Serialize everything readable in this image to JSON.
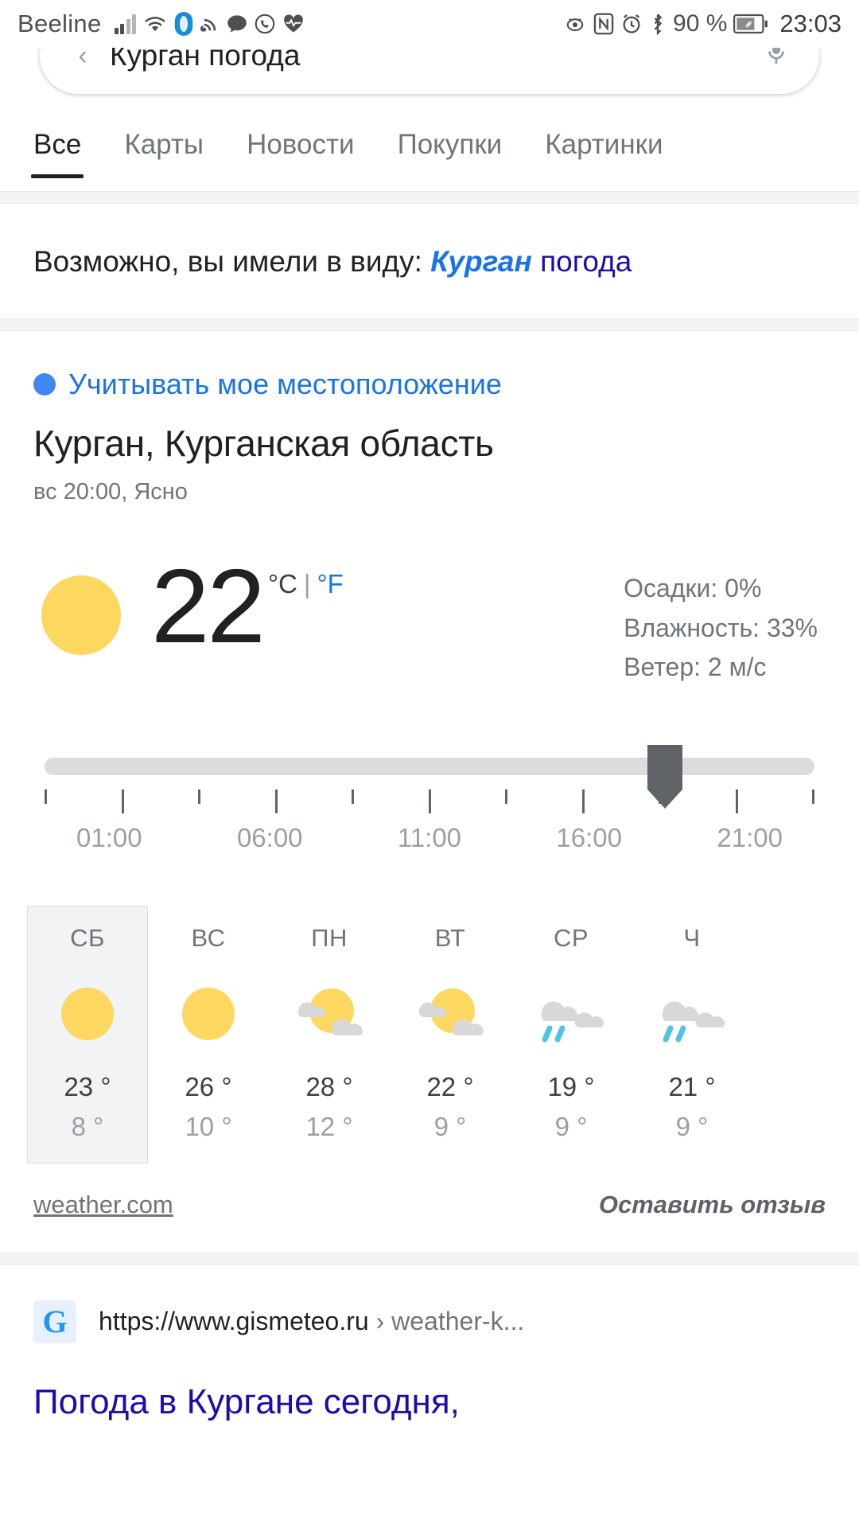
{
  "statusbar": {
    "carrier": "Beeline",
    "battery": "90 %",
    "time": "23:03",
    "icons": [
      "signal-bars-icon",
      "wifi-icon",
      "vpn-shield-icon",
      "cast-icon",
      "message-icon",
      "whatsapp-icon",
      "heartbeat-icon"
    ],
    "right_icons": [
      "eye-off-icon",
      "nfc-icon",
      "alarm-icon",
      "bluetooth-icon",
      "battery-icon"
    ]
  },
  "search": {
    "query": "Курган погода",
    "back_icon": "back-arrow-icon",
    "mic_icon": "microphone-icon"
  },
  "tabs": [
    {
      "label": "Все",
      "active": true
    },
    {
      "label": "Карты",
      "active": false
    },
    {
      "label": "Новости",
      "active": false
    },
    {
      "label": "Покупки",
      "active": false
    },
    {
      "label": "Картинки",
      "active": false
    }
  ],
  "did_you_mean": {
    "prefix": "Возможно, вы имели в виду: ",
    "query_bold": "Курган",
    "query_rest": " погода"
  },
  "weather": {
    "use_location_label": "Учитывать мое местоположение",
    "location": "Курган, Курганская область",
    "observed": "вс 20:00, Ясно",
    "temperature": "22",
    "unit_c": "°C",
    "unit_divider": "|",
    "unit_f": "°F",
    "condition_icon": "sun-icon",
    "stats": {
      "precipitation": "Осадки: 0%",
      "humidity": "Влажность: 33%",
      "wind": "Ветер: 2 м/с"
    },
    "slider": {
      "position_percent": 77.5,
      "hour_labels": [
        "01:00",
        "06:00",
        "11:00",
        "16:00",
        "21:00"
      ]
    },
    "forecast": [
      {
        "day": "СБ",
        "icon": "sun-icon",
        "high": "23 °",
        "low": "8 °",
        "selected": true
      },
      {
        "day": "ВС",
        "icon": "sun-icon",
        "high": "26 °",
        "low": "10 °",
        "selected": false
      },
      {
        "day": "ПН",
        "icon": "partly-cloudy-icon",
        "high": "28 °",
        "low": "12 °",
        "selected": false
      },
      {
        "day": "ВТ",
        "icon": "partly-cloudy-icon",
        "high": "22 °",
        "low": "9 °",
        "selected": false
      },
      {
        "day": "СР",
        "icon": "rain-icon",
        "high": "19 °",
        "low": "9 °",
        "selected": false
      },
      {
        "day": "Ч",
        "icon": "rain-icon",
        "high": "21 °",
        "low": "9 °",
        "selected": false
      }
    ],
    "source_link": "weather.com",
    "feedback_link": "Оставить отзыв"
  },
  "result": {
    "favicon_letter": "G",
    "url": "https://www.gismeteo.ru",
    "path": " › weather-k...",
    "title": "Погода в Кургане сегодня,"
  },
  "colors": {
    "accent_blue": "#1a73e8",
    "link_blue": "#1a0dab",
    "sun_yellow": "#FCD860",
    "cloud_gray": "#d8d8d8",
    "rain_blue": "#4FC3E8"
  }
}
